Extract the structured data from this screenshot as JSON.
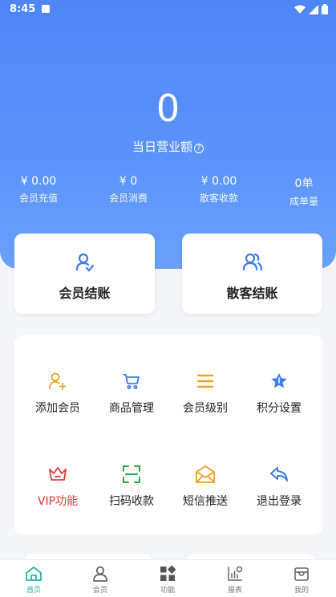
{
  "status_bar": {
    "time": "8:45"
  },
  "summary": {
    "total": "0",
    "total_label": "当日营业额",
    "help_symbol": "?"
  },
  "stats": [
    {
      "value": "¥ 0.00",
      "label": "会员充值"
    },
    {
      "value": "¥ 0",
      "label": "会员消费"
    },
    {
      "value": "¥ 0.00",
      "label": "散客收款"
    },
    {
      "value": "0单",
      "label": "成单量"
    }
  ],
  "checkout": {
    "member": "会员结账",
    "guest": "散客结账"
  },
  "functions": [
    {
      "label": "添加会员",
      "icon": "add-user-icon"
    },
    {
      "label": "商品管理",
      "icon": "cart-icon"
    },
    {
      "label": "会员级别",
      "icon": "menu-icon"
    },
    {
      "label": "积分设置",
      "icon": "star-icon"
    },
    {
      "label": "VIP功能",
      "icon": "crown-icon"
    },
    {
      "label": "扫码收款",
      "icon": "scan-icon"
    },
    {
      "label": "短信推送",
      "icon": "mail-icon"
    },
    {
      "label": "退出登录",
      "icon": "reply-icon"
    }
  ],
  "nav": [
    {
      "label": "首页",
      "icon": "home-icon",
      "active": true
    },
    {
      "label": "会员",
      "icon": "user-icon"
    },
    {
      "label": "功能",
      "icon": "grid-icon"
    },
    {
      "label": "报表",
      "icon": "chart-icon"
    },
    {
      "label": "我的",
      "icon": "store-icon"
    }
  ],
  "colors": {
    "primary": "#4d86f7",
    "orange": "#f3a022",
    "blue": "#3d7cf0",
    "green": "#23a84e",
    "red": "#e53935",
    "nav_active": "#2bb5a3"
  }
}
